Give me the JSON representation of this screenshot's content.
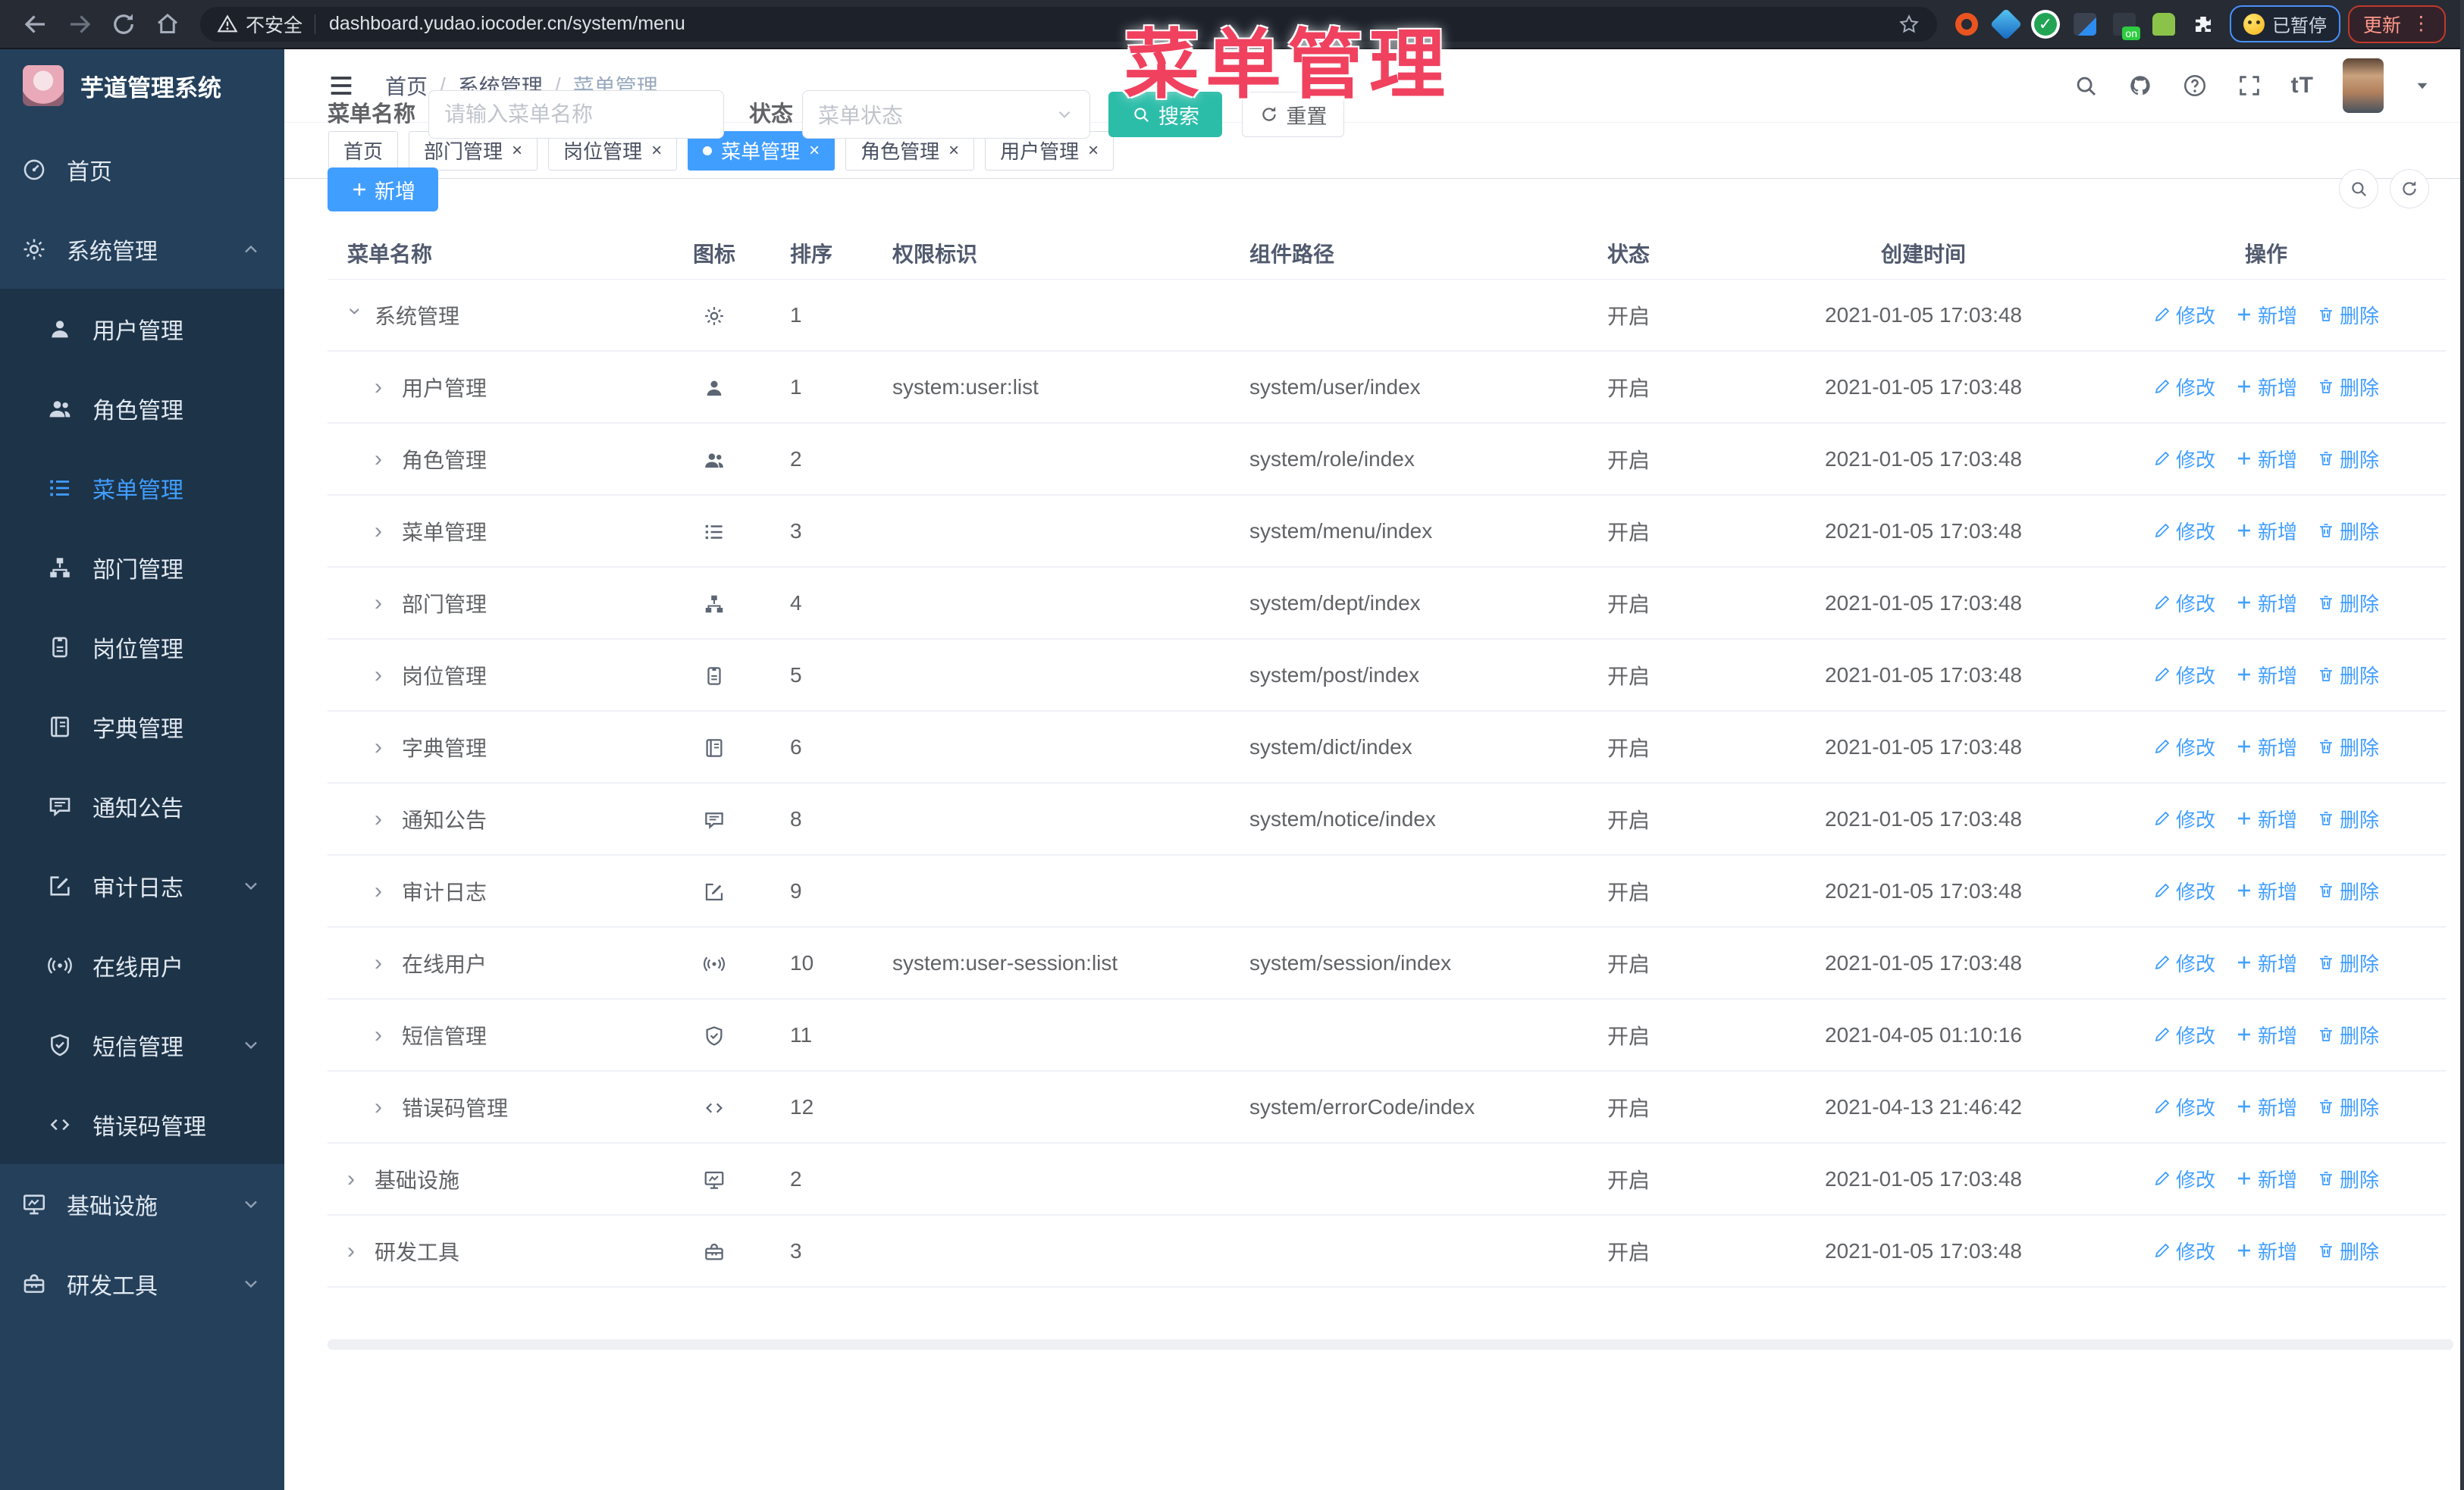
{
  "browser": {
    "security_label": "不安全",
    "url": "dashboard.yudao.iocoder.cn/system/menu",
    "paused_badge": "已暂停",
    "update_label": "更新"
  },
  "overlay": {
    "annotation": "菜单管理"
  },
  "sidebar": {
    "title": "芋道管理系统",
    "items": [
      {
        "label": "首页",
        "icon": "dashboard",
        "level": 0
      },
      {
        "label": "系统管理",
        "icon": "gear",
        "level": 0,
        "chevron": "up",
        "expanded": true
      },
      {
        "label": "用户管理",
        "icon": "user",
        "level": 1
      },
      {
        "label": "角色管理",
        "icon": "users",
        "level": 1
      },
      {
        "label": "菜单管理",
        "icon": "list",
        "level": 1,
        "active": true
      },
      {
        "label": "部门管理",
        "icon": "tree",
        "level": 1
      },
      {
        "label": "岗位管理",
        "icon": "badge",
        "level": 1
      },
      {
        "label": "字典管理",
        "icon": "book",
        "level": 1
      },
      {
        "label": "通知公告",
        "icon": "message",
        "level": 1
      },
      {
        "label": "审计日志",
        "icon": "edit",
        "level": 1,
        "chevron": "down"
      },
      {
        "label": "在线用户",
        "icon": "online",
        "level": 1
      },
      {
        "label": "短信管理",
        "icon": "shield",
        "level": 1,
        "chevron": "down"
      },
      {
        "label": "错误码管理",
        "icon": "code",
        "level": 1
      },
      {
        "label": "基础设施",
        "icon": "monitor",
        "level": 0,
        "chevron": "down"
      },
      {
        "label": "研发工具",
        "icon": "toolbox",
        "level": 0,
        "chevron": "down"
      }
    ]
  },
  "header": {
    "breadcrumb": [
      "首页",
      "系统管理",
      "菜单管理"
    ]
  },
  "tabs": [
    {
      "label": "首页",
      "closable": false,
      "active": false
    },
    {
      "label": "部门管理",
      "closable": true,
      "active": false
    },
    {
      "label": "岗位管理",
      "closable": true,
      "active": false
    },
    {
      "label": "菜单管理",
      "closable": true,
      "active": true
    },
    {
      "label": "角色管理",
      "closable": true,
      "active": false
    },
    {
      "label": "用户管理",
      "closable": true,
      "active": false
    }
  ],
  "filters": {
    "name_label": "菜单名称",
    "name_placeholder": "请输入菜单名称",
    "status_label": "状态",
    "status_placeholder": "菜单状态",
    "search_label": "搜索",
    "reset_label": "重置"
  },
  "toolbar": {
    "add_label": "新增"
  },
  "table": {
    "columns": [
      "菜单名称",
      "图标",
      "排序",
      "权限标识",
      "组件路径",
      "状态",
      "创建时间",
      "操作"
    ],
    "actions": {
      "edit": "修改",
      "add": "新增",
      "delete": "删除"
    },
    "rows": [
      {
        "name": "系统管理",
        "icon": "gear",
        "level": 0,
        "expanded": true,
        "sort": "1",
        "perm": "",
        "path": "",
        "status": "开启",
        "created": "2021-01-05 17:03:48"
      },
      {
        "name": "用户管理",
        "icon": "user",
        "level": 1,
        "expanded": false,
        "sort": "1",
        "perm": "system:user:list",
        "path": "system/user/index",
        "status": "开启",
        "created": "2021-01-05 17:03:48"
      },
      {
        "name": "角色管理",
        "icon": "users",
        "level": 1,
        "expanded": false,
        "sort": "2",
        "perm": "",
        "path": "system/role/index",
        "status": "开启",
        "created": "2021-01-05 17:03:48"
      },
      {
        "name": "菜单管理",
        "icon": "list",
        "level": 1,
        "expanded": false,
        "sort": "3",
        "perm": "",
        "path": "system/menu/index",
        "status": "开启",
        "created": "2021-01-05 17:03:48"
      },
      {
        "name": "部门管理",
        "icon": "tree",
        "level": 1,
        "expanded": false,
        "sort": "4",
        "perm": "",
        "path": "system/dept/index",
        "status": "开启",
        "created": "2021-01-05 17:03:48"
      },
      {
        "name": "岗位管理",
        "icon": "badge",
        "level": 1,
        "expanded": false,
        "sort": "5",
        "perm": "",
        "path": "system/post/index",
        "status": "开启",
        "created": "2021-01-05 17:03:48"
      },
      {
        "name": "字典管理",
        "icon": "book",
        "level": 1,
        "expanded": false,
        "sort": "6",
        "perm": "",
        "path": "system/dict/index",
        "status": "开启",
        "created": "2021-01-05 17:03:48"
      },
      {
        "name": "通知公告",
        "icon": "message",
        "level": 1,
        "expanded": false,
        "sort": "8",
        "perm": "",
        "path": "system/notice/index",
        "status": "开启",
        "created": "2021-01-05 17:03:48"
      },
      {
        "name": "审计日志",
        "icon": "edit",
        "level": 1,
        "expanded": false,
        "sort": "9",
        "perm": "",
        "path": "",
        "status": "开启",
        "created": "2021-01-05 17:03:48"
      },
      {
        "name": "在线用户",
        "icon": "online",
        "level": 1,
        "expanded": false,
        "sort": "10",
        "perm": "system:user-session:list",
        "path": "system/session/index",
        "status": "开启",
        "created": "2021-01-05 17:03:48"
      },
      {
        "name": "短信管理",
        "icon": "shield",
        "level": 1,
        "expanded": false,
        "sort": "11",
        "perm": "",
        "path": "",
        "status": "开启",
        "created": "2021-04-05 01:10:16"
      },
      {
        "name": "错误码管理",
        "icon": "code",
        "level": 1,
        "expanded": false,
        "sort": "12",
        "perm": "",
        "path": "system/errorCode/index",
        "status": "开启",
        "created": "2021-04-13 21:46:42"
      },
      {
        "name": "基础设施",
        "icon": "monitor",
        "level": 0,
        "expanded": false,
        "sort": "2",
        "perm": "",
        "path": "",
        "status": "开启",
        "created": "2021-01-05 17:03:48"
      },
      {
        "name": "研发工具",
        "icon": "toolbox",
        "level": 0,
        "expanded": false,
        "sort": "3",
        "perm": "",
        "path": "",
        "status": "开启",
        "created": "2021-01-05 17:03:48"
      }
    ]
  },
  "colors": {
    "accent": "#409eff",
    "search_button": "#2cbda9",
    "annotation": "#f0415f",
    "sidebar_bg": "#24405b",
    "submenu_bg": "#1d3348",
    "browser_bar": "#262b34"
  }
}
